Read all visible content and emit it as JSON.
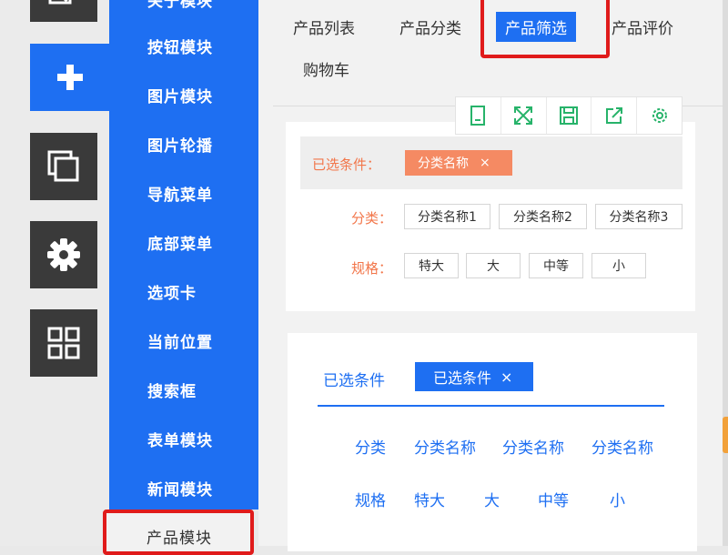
{
  "side_menu": {
    "items": [
      {
        "label": "关于模块"
      },
      {
        "label": "按钮模块"
      },
      {
        "label": "图片模块"
      },
      {
        "label": "图片轮播"
      },
      {
        "label": "导航菜单"
      },
      {
        "label": "底部菜单"
      },
      {
        "label": "选项卡"
      },
      {
        "label": "当前位置"
      },
      {
        "label": "搜索框"
      },
      {
        "label": "表单模块"
      },
      {
        "label": "新闻模块"
      },
      {
        "label": "产品模块"
      }
    ]
  },
  "tabs": [
    "产品列表",
    "产品分类",
    "产品筛选",
    "产品评价",
    "购物车"
  ],
  "toolbar_icons": [
    "mobile-icon",
    "expand-icon",
    "save-icon",
    "share-icon",
    "gear-icon"
  ],
  "style1": {
    "selected_label": "已选条件：",
    "selected_tag": "分类名称",
    "close": "×",
    "category_label": "分类：",
    "categories": [
      "分类名称1",
      "分类名称2",
      "分类名称3"
    ],
    "spec_label": "规格：",
    "specs": [
      "特大",
      "大",
      "中等",
      "小"
    ]
  },
  "style2": {
    "selected_label": "已选条件",
    "selected_tag": "已选条件",
    "close": "×",
    "category_label": "分类",
    "categories": [
      "分类名称",
      "分类名称",
      "分类名称"
    ],
    "spec_label": "规格",
    "specs": [
      "特大",
      "大",
      "中等",
      "小"
    ]
  },
  "colors": {
    "primary": "#1e6ff2",
    "accent": "#f2764a",
    "highlight_border": "#e01b1b"
  }
}
